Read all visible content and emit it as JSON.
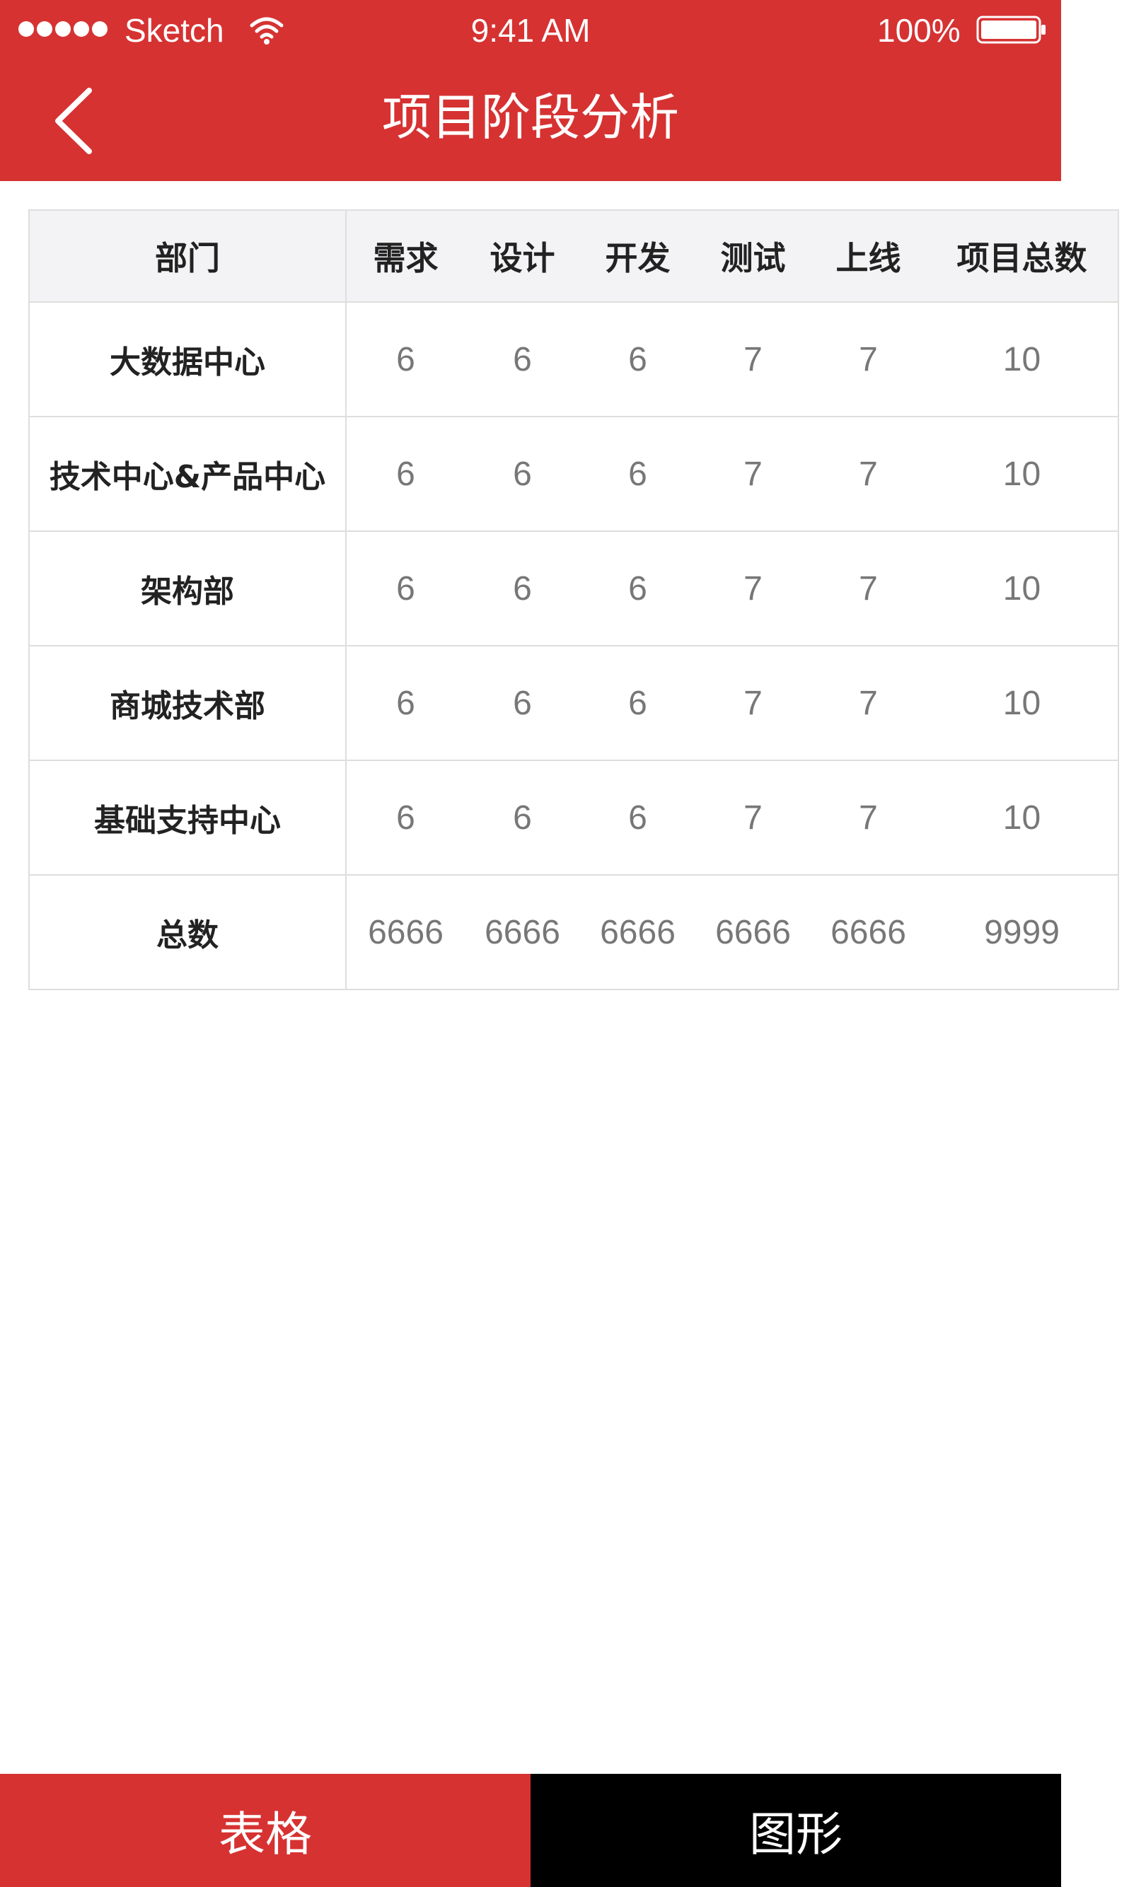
{
  "status_bar": {
    "carrier": "Sketch",
    "time": "9:41 AM",
    "battery": "100%"
  },
  "nav": {
    "title": "项目阶段分析",
    "back_icon": "chevron-left-icon"
  },
  "table": {
    "headers": [
      "部门",
      "需求",
      "设计",
      "开发",
      "测试",
      "上线",
      "项目总数"
    ],
    "rows": [
      {
        "dept": "大数据中心",
        "values": [
          "6",
          "6",
          "6",
          "7",
          "7",
          "10"
        ]
      },
      {
        "dept": "技术中心&产品中心",
        "values": [
          "6",
          "6",
          "6",
          "7",
          "7",
          "10"
        ]
      },
      {
        "dept": "架构部",
        "values": [
          "6",
          "6",
          "6",
          "7",
          "7",
          "10"
        ]
      },
      {
        "dept": "商城技术部",
        "values": [
          "6",
          "6",
          "6",
          "7",
          "7",
          "10"
        ]
      },
      {
        "dept": "基础支持中心",
        "values": [
          "6",
          "6",
          "6",
          "7",
          "7",
          "10"
        ]
      },
      {
        "dept": "总数",
        "values": [
          "6666",
          "6666",
          "6666",
          "6666",
          "6666",
          "9999"
        ]
      }
    ]
  },
  "tabs": [
    {
      "label": "表格",
      "active": true
    },
    {
      "label": "图形",
      "active": false
    }
  ],
  "colors": {
    "brand_red": "#d63232",
    "tab_inactive": "#000000"
  }
}
